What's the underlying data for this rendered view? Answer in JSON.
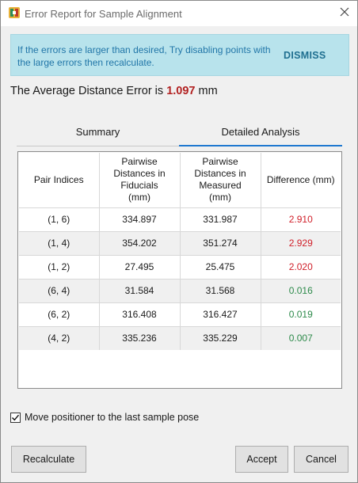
{
  "window": {
    "title": "Error Report for Sample Alignment",
    "app_icon": "app-logo-icon",
    "close_icon": "close-icon"
  },
  "banner": {
    "message": "If the errors are larger than desired, Try disabling points with the large errors then recalculate.",
    "dismiss_label": "DISMISS"
  },
  "summary": {
    "prefix": "The Average Distance Error is",
    "value": "1.097",
    "unit": "mm"
  },
  "tabs": {
    "summary_label": "Summary",
    "detailed_label": "Detailed Analysis",
    "active": "Detailed Analysis"
  },
  "table": {
    "headers": [
      "Pair Indices",
      "Pairwise Distances in Fiducials (mm)",
      "Pairwise Distances in Measured (mm)",
      "Difference (mm)"
    ],
    "rows": [
      {
        "pair": "(1, 6)",
        "fiducials": "334.897",
        "measured": "331.987",
        "difference": "2.910",
        "status": "high"
      },
      {
        "pair": "(1, 4)",
        "fiducials": "354.202",
        "measured": "351.274",
        "difference": "2.929",
        "status": "high"
      },
      {
        "pair": "(1, 2)",
        "fiducials": "27.495",
        "measured": "25.475",
        "difference": "2.020",
        "status": "high"
      },
      {
        "pair": "(6, 4)",
        "fiducials": "31.584",
        "measured": "31.568",
        "difference": "0.016",
        "status": "ok"
      },
      {
        "pair": "(6, 2)",
        "fiducials": "316.408",
        "measured": "316.427",
        "difference": "0.019",
        "status": "ok"
      },
      {
        "pair": "(4, 2)",
        "fiducials": "335.236",
        "measured": "335.229",
        "difference": "0.007",
        "status": "ok"
      }
    ]
  },
  "colors": {
    "high_error": "#d0202a",
    "ok_error": "#2d8a4a",
    "banner_bg": "#b8e3ec",
    "tab_accent": "#1e78d0"
  },
  "options": {
    "move_positioner_label": "Move positioner to the last sample pose",
    "move_positioner_checked": true
  },
  "buttons": {
    "recalculate": "Recalculate",
    "accept": "Accept",
    "cancel": "Cancel"
  }
}
